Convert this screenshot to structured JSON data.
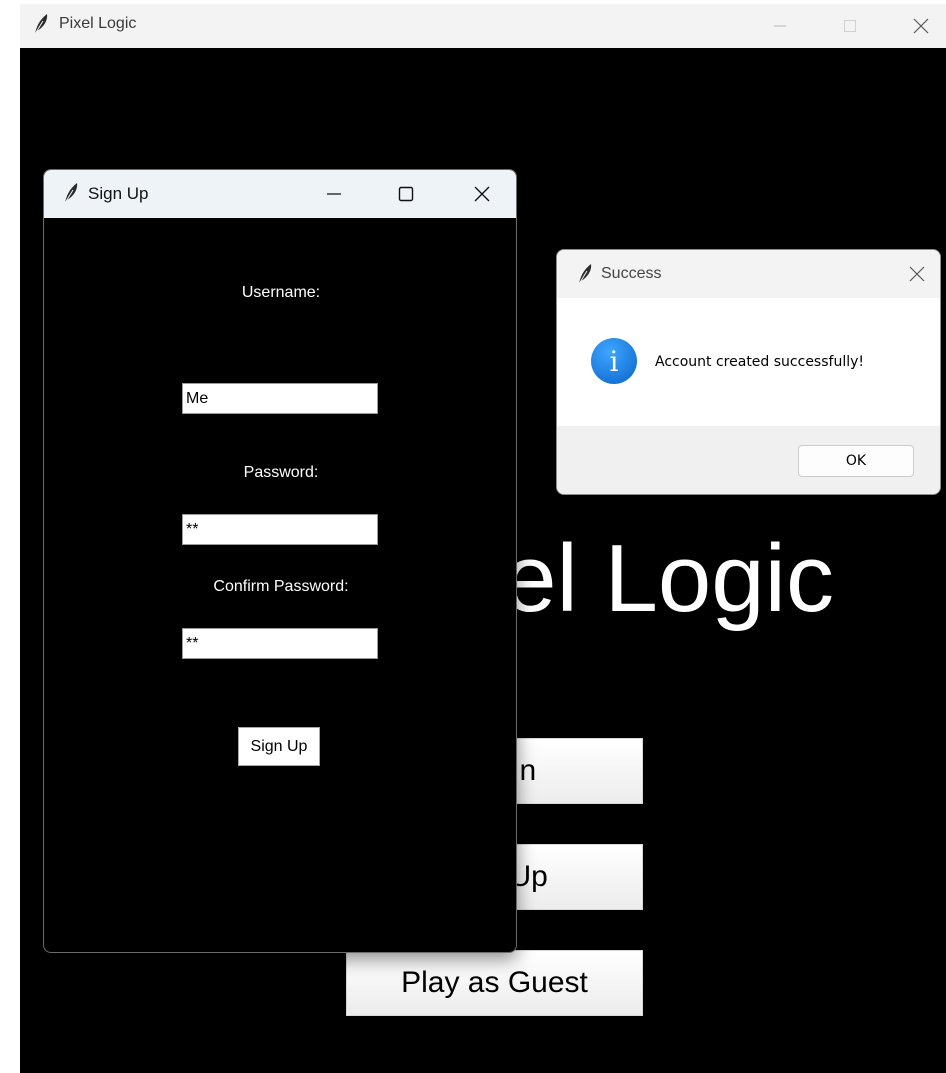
{
  "main_window": {
    "title": "Pixel Logic",
    "heading": "Pixel Logic",
    "buttons": {
      "login": "Log In",
      "signup": "Sign Up",
      "guest": "Play as Guest"
    }
  },
  "signup_window": {
    "title": "Sign Up",
    "username_label": "Username:",
    "username_value": "Me",
    "password_label": "Password:",
    "password_value": "**",
    "confirm_label": "Confirm Password:",
    "confirm_value": "**",
    "submit_label": "Sign Up"
  },
  "success_dialog": {
    "title": "Success",
    "message": "Account created successfully!",
    "ok_label": "OK"
  },
  "icons": {
    "app": "feather-icon",
    "info": "info-icon",
    "minimize": "minimize-icon",
    "maximize": "maximize-icon",
    "close": "close-icon"
  }
}
